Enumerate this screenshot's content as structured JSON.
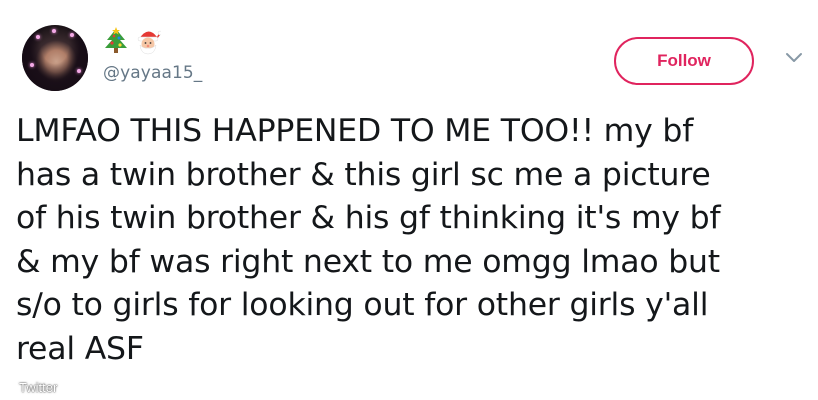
{
  "user": {
    "display_name_icons": [
      "christmas-tree-icon",
      "santa-claus-icon"
    ],
    "handle": "@yayaa15_"
  },
  "follow_button": {
    "label": "Follow",
    "color": "#e0245e"
  },
  "tweet": {
    "text": "LMFAO THIS HAPPENED TO ME TOO!! my bf\nhas a twin brother & this girl sc me a picture\nof his twin brother & his gf thinking it's my bf\n& my bf was right next to me omgg lmao but\ns/o to girls for looking out for other girls y'all\nreal ASF"
  },
  "credit": {
    "label": "Twitter"
  }
}
